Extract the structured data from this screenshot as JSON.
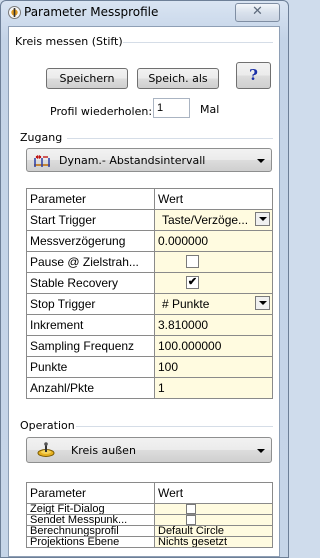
{
  "window": {
    "title": "Parameter Messprofile",
    "close_glyph": "✕"
  },
  "kreis": {
    "group_label": "Kreis messen (Stift)",
    "save_label": "Speichern",
    "save_as_label": "Speich. als",
    "help_label": "?",
    "repeat_label": "Profil wiederholen:",
    "repeat_value": "1",
    "repeat_unit": "Mal"
  },
  "zugang": {
    "group_label": "Zugang",
    "combo_value": "Dynam.- Abstandsintervall",
    "combo_icon": "distance-interval-icon"
  },
  "param_table": {
    "header": [
      "Parameter",
      "Wert"
    ],
    "rows": [
      {
        "name": "Start Trigger",
        "value": "Taste/Verzöge...",
        "kind": "select"
      },
      {
        "name": "Messverzögerung",
        "value": "0.000000",
        "kind": "text"
      },
      {
        "name": "Pause @ Zielstrah...",
        "value": "",
        "kind": "checkbox",
        "checked": false
      },
      {
        "name": "Stable Recovery",
        "value": "",
        "kind": "checkbox",
        "checked": true
      },
      {
        "name": "Stop Trigger",
        "value": "# Punkte",
        "kind": "select"
      },
      {
        "name": "Inkrement",
        "value": "3.810000",
        "kind": "text"
      },
      {
        "name": "Sampling Frequenz",
        "value": "100.000000",
        "kind": "text"
      },
      {
        "name": "Punkte",
        "value": "100",
        "kind": "text"
      },
      {
        "name": "Anzahl/Pkte",
        "value": "1",
        "kind": "text"
      }
    ]
  },
  "operation": {
    "group_label": "Operation",
    "combo_value": "Kreis außen",
    "combo_icon": "circle-outside-icon"
  },
  "op_table": {
    "header": [
      "Parameter",
      "Wert"
    ],
    "rows": [
      {
        "name": "Zeigt Fit-Dialog",
        "value": "",
        "kind": "checkbox",
        "checked": false
      },
      {
        "name": "Sendet Messpunk...",
        "value": "",
        "kind": "checkbox",
        "checked": false
      },
      {
        "name": "Berechnungsprofil",
        "value": "Default Circle",
        "kind": "text"
      },
      {
        "name": "Projektions Ebene",
        "value": "Nichts gesetzt",
        "kind": "text"
      }
    ]
  },
  "colors": {
    "value_cell_bg": "#fffbe0",
    "frame_bg": "#cfdcec",
    "help_color": "#1a2fa8"
  }
}
